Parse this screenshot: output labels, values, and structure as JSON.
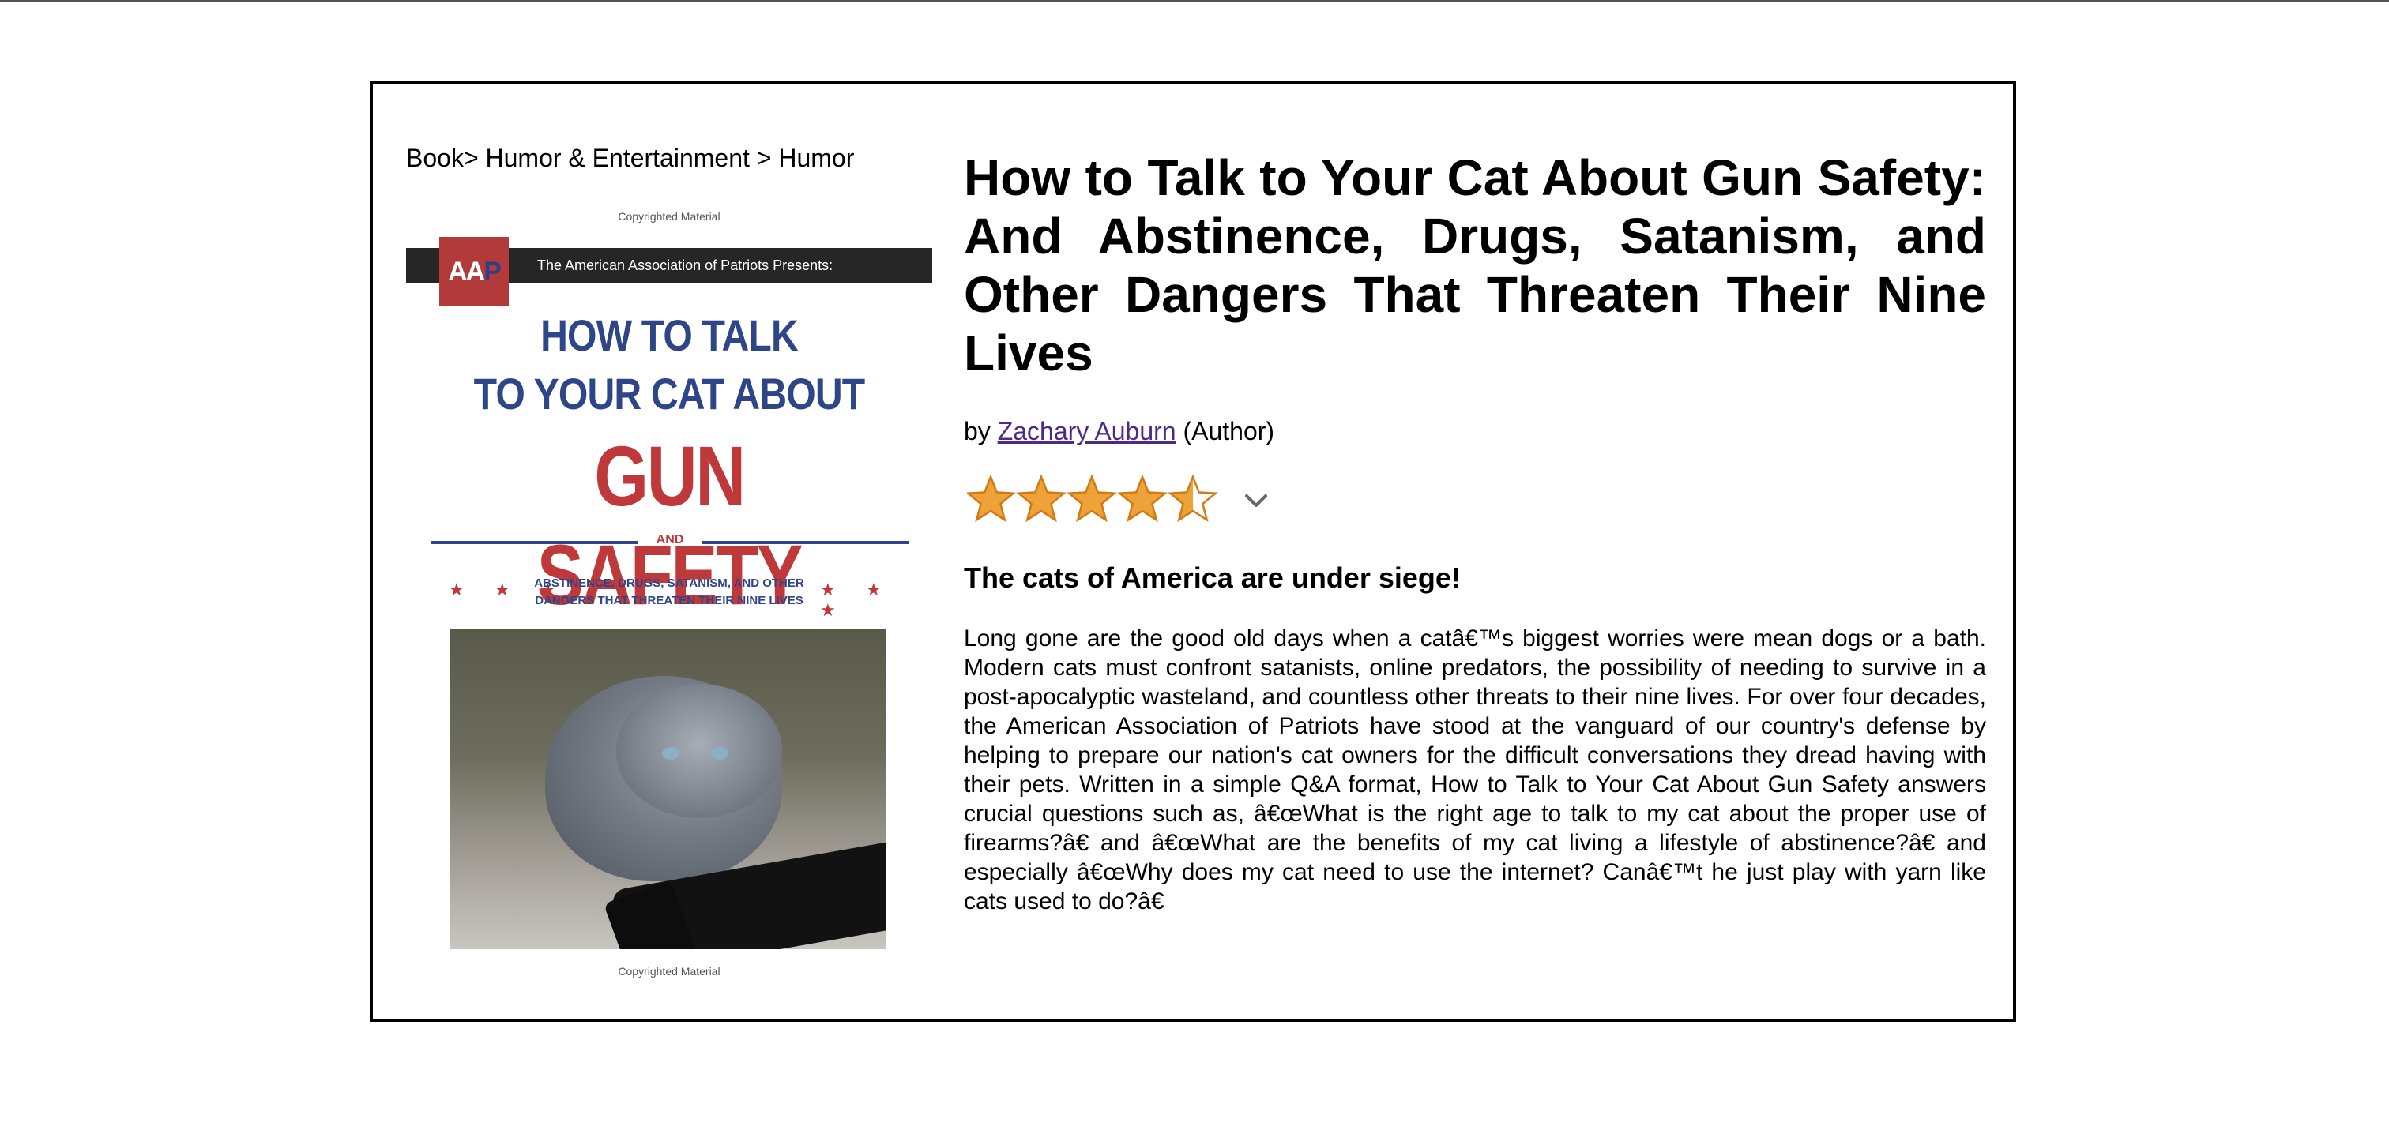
{
  "breadcrumb": "Book> Humor & Entertainment > Humor",
  "cover": {
    "copyright_top": "Copyrighted Material",
    "copyright_bottom": "Copyrighted Material",
    "logo_a1": "A",
    "logo_a2": "A",
    "logo_p": "P",
    "banner": "The American Association of Patriots Presents:",
    "line1": "HOW TO TALK",
    "line2": "TO YOUR CAT ABOUT",
    "line3": "GUN SAFETY",
    "and": "AND",
    "stars_left": "★ ★ ★",
    "stars_right": "★ ★ ★",
    "sub1": "ABSTINENCE, DRUGS, SATANISM, AND OTHER",
    "sub2": "DANGERS THAT THREATEN THEIR NINE LIVES"
  },
  "product": {
    "title": "How to Talk to Your Cat About Gun Safety: And Abstinence, Drugs, Satanism, and Other Dangers That Threaten Their Nine Lives",
    "by": "by",
    "author": "Zachary Auburn",
    "author_role": "(Author)",
    "rating": 4.5,
    "rating_max": 5,
    "star_color": "#f0a23a",
    "star_stroke": "#d07c14",
    "headline": "The cats of America are under siege!",
    "description": "Long gone are the good old days when a catâ€™s biggest worries were mean dogs or a bath. Modern cats must confront satanists, online predators, the possibility of needing to survive in a post-apocalyptic wasteland, and countless other threats to their nine lives. For over four decades, the American Association of Patriots have stood at the vanguard of our country's defense by helping to prepare our nation's cat owners for the difficult conversations they dread having with their pets. Written in a simple Q&A format, How to Talk to Your Cat About Gun Safety answers crucial questions such as, â€œWhat is the right age to talk to my cat about the proper use of firearms?â€  and â€œWhat are the benefits of my cat living a lifestyle of abstinence?â€  and especially â€œWhy does my cat need to use the internet? Canâ€™t he just play with yarn like cats used to do?â€"
  }
}
